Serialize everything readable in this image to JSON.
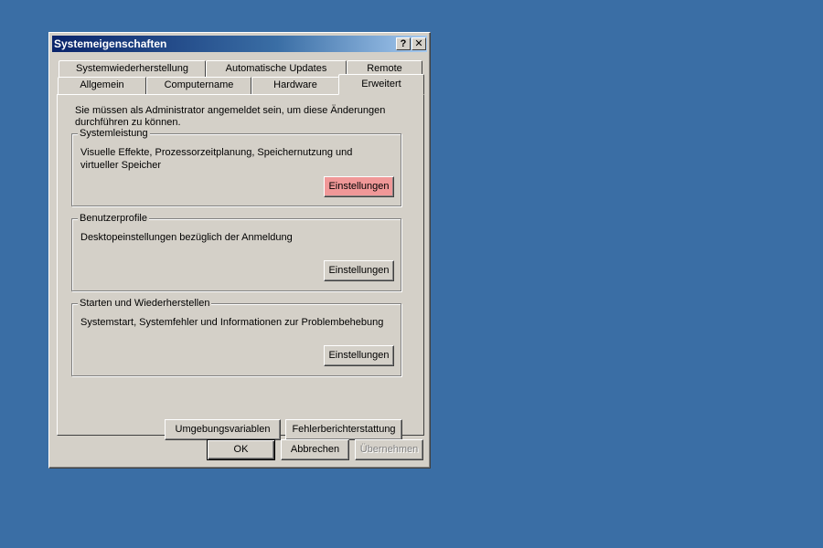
{
  "window": {
    "title": "Systemeigenschaften",
    "help_glyph": "?",
    "close_glyph": "✕"
  },
  "tabs": {
    "row1": [
      "Systemwiederherstellung",
      "Automatische Updates",
      "Remote"
    ],
    "row2": [
      "Allgemein",
      "Computername",
      "Hardware",
      "Erweitert"
    ],
    "active": "Erweitert"
  },
  "panel": {
    "intro": "Sie müssen als Administrator angemeldet sein, um diese Änderungen durchführen zu können.",
    "groups": [
      {
        "title": "Systemleistung",
        "text": "Visuelle Effekte, Prozessorzeitplanung, Speichernutzung und virtueller Speicher",
        "button": "Einstellungen"
      },
      {
        "title": "Benutzerprofile",
        "text": "Desktopeinstellungen bezüglich der Anmeldung",
        "button": "Einstellungen"
      },
      {
        "title": "Starten und Wiederherstellen",
        "text": "Systemstart, Systemfehler und Informationen zur Problembehebung",
        "button": "Einstellungen"
      }
    ],
    "env_button": "Umgebungsvariablen",
    "error_button": "Fehlerberichterstattung"
  },
  "footer": {
    "ok": "OK",
    "cancel": "Abbrechen",
    "apply": "Übernehmen"
  },
  "colors": {
    "desktop": "#3a6ea5",
    "highlight_button": "#f09898"
  }
}
